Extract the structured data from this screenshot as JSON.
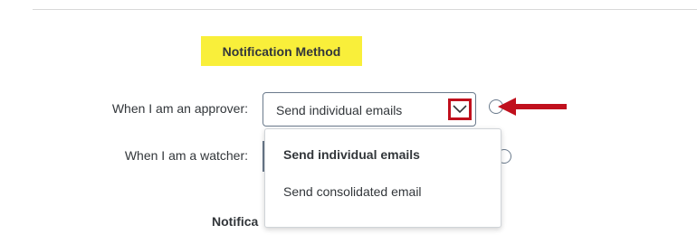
{
  "section": {
    "heading": "Notification Method"
  },
  "approver": {
    "label": "When I am an approver:",
    "selected": "Send individual emails"
  },
  "watcher": {
    "label": "When I am a watcher:"
  },
  "dropdown": {
    "options": [
      {
        "label": "Send individual emails",
        "selected": true
      },
      {
        "label": "Send consolidated email",
        "selected": false
      }
    ]
  },
  "next_section": {
    "heading_visible_part": "Notifica"
  },
  "colors": {
    "highlight": "#f9ef3a",
    "annotation_red": "#c0101d",
    "text": "#32363a"
  },
  "icons": {
    "toggle": "chevron-down-icon",
    "annotation": "red-arrow-icon"
  }
}
